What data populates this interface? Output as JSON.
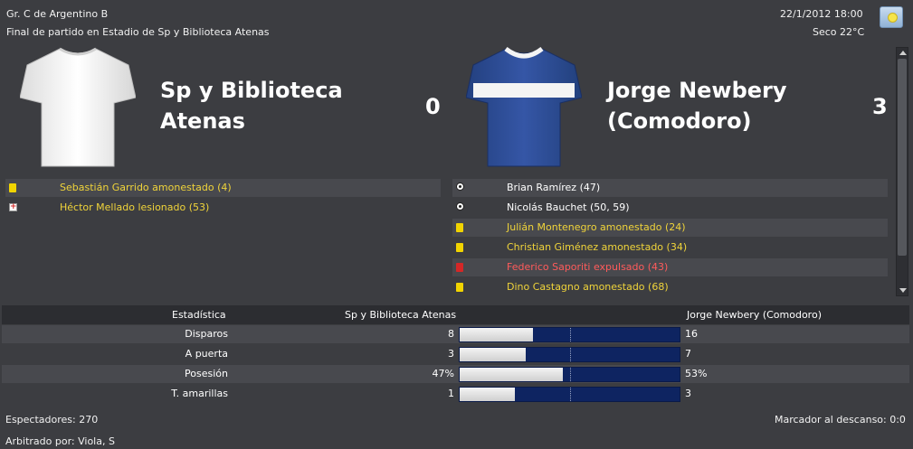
{
  "header": {
    "competition": "Gr. C de Argentino B",
    "match_status": "Final de partido en Estadio de Sp y Biblioteca Atenas",
    "datetime": "22/1/2012 18:00",
    "weather": "Seco 22°C",
    "weather_icon": "sun-icon"
  },
  "home": {
    "name_line1": "Sp y Biblioteca",
    "name_line2": "Atenas",
    "score": "0",
    "shirt_color": "#f2f2f2",
    "events": [
      {
        "type": "yellow-card",
        "text": "Sebastián Garrido amonestado (4)",
        "color": "yellow"
      },
      {
        "type": "injury",
        "text": "Héctor Mellado lesionado (53)",
        "color": "yellow"
      }
    ]
  },
  "away": {
    "name_line1": "Jorge Newbery",
    "name_line2": "(Comodoro)",
    "score": "3",
    "shirt_color": "#2a4a9c",
    "events": [
      {
        "type": "goal",
        "text": "Brian Ramírez (47)",
        "color": "white"
      },
      {
        "type": "goal",
        "text": "Nicolás Bauchet (50, 59)",
        "color": "white"
      },
      {
        "type": "yellow-card",
        "text": "Julián Montenegro amonestado (24)",
        "color": "yellow"
      },
      {
        "type": "yellow-card",
        "text": "Christian Giménez amonestado (34)",
        "color": "yellow"
      },
      {
        "type": "red-card",
        "text": "Federico Saporiti expulsado (43)",
        "color": "red"
      },
      {
        "type": "yellow-card",
        "text": "Dino Castagno amonestado (68)",
        "color": "yellow"
      }
    ]
  },
  "stats": {
    "header_label": "Estadística",
    "header_home": "Sp y Biblioteca Atenas",
    "header_away": "Jorge Newbery (Comodoro)",
    "rows": [
      {
        "label": "Disparos",
        "home": "8",
        "away": "16",
        "home_share": 0.333
      },
      {
        "label": "A puerta",
        "home": "3",
        "away": "7",
        "home_share": 0.3
      },
      {
        "label": "Posesión",
        "home": "47%",
        "away": "53%",
        "home_share": 0.47
      },
      {
        "label": "T. amarillas",
        "home": "1",
        "away": "3",
        "home_share": 0.25
      }
    ]
  },
  "footer": {
    "attendance": "Espectadores: 270",
    "halftime": "Marcador al descanso: 0:0",
    "referee": "Arbitrado por: Viola, S"
  },
  "colors": {
    "background": "#3c3d41",
    "yellow_text": "#f0d43a",
    "red_text": "#ff5b5b",
    "bar_home": "#e6e6e6",
    "bar_away": "#0e2461"
  }
}
